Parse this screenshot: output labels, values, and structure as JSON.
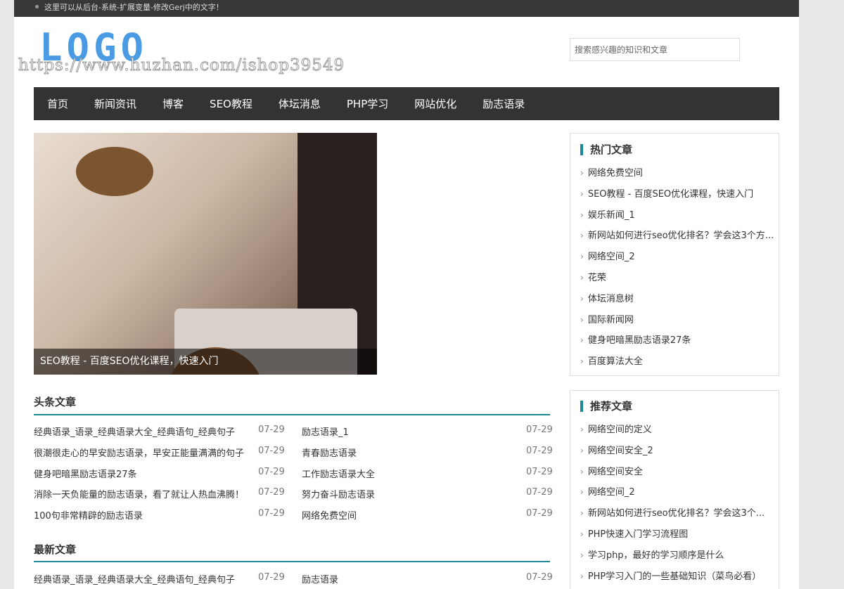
{
  "topbar": {
    "text": "这里可以从后台-系统-扩展变量-修改Gerj中的文字！"
  },
  "logo": {
    "text": "LOGO",
    "watermark": "https://www.huzhan.com/ishop39549"
  },
  "search": {
    "placeholder": "搜索感兴趣的知识和文章"
  },
  "nav": [
    "首页",
    "新闻资讯",
    "博客",
    "SEO教程",
    "体坛消息",
    "PHP学习",
    "网站优化",
    "励志语录"
  ],
  "hero": {
    "caption": "SEO教程 - 百度SEO优化课程，快速入门"
  },
  "headline": {
    "title": "头条文章",
    "left": [
      {
        "t": "经典语录_语录_经典语录大全_经典语句_经典句子",
        "d": "07-29"
      },
      {
        "t": "很潮很走心的早安励志语录，早安正能量满满的句子",
        "d": "07-29"
      },
      {
        "t": "健身吧暗黑励志语录27条",
        "d": "07-29"
      },
      {
        "t": "消除一天负能量的励志语录，看了就让人热血沸腾！",
        "d": "07-29"
      },
      {
        "t": "100句非常精辟的励志语录",
        "d": "07-29"
      }
    ],
    "right": [
      {
        "t": "励志语录_1",
        "d": "07-29"
      },
      {
        "t": "青春励志语录",
        "d": "07-29"
      },
      {
        "t": "工作励志语录大全",
        "d": "07-29"
      },
      {
        "t": "努力奋斗励志语录",
        "d": "07-29"
      },
      {
        "t": "网络免费空间",
        "d": "07-29"
      }
    ]
  },
  "latest": {
    "title": "最新文章",
    "left": [
      {
        "t": "经典语录_语录_经典语录大全_经典语句_经典句子",
        "d": "07-29"
      }
    ],
    "right": [
      {
        "t": "励志语录",
        "d": "07-29"
      }
    ]
  },
  "hot": {
    "title": "热门文章",
    "items": [
      "网络免费空间",
      "SEO教程 - 百度SEO优化课程，快速入门",
      "娱乐新闻_1",
      "新网站如何进行seo优化排名？学会这3个方...",
      "网络空间_2",
      "花荣",
      "体坛消息树",
      "国际新闻网",
      "健身吧暗黑励志语录27条",
      "百度算法大全"
    ]
  },
  "recommend": {
    "title": "推荐文章",
    "items": [
      "网络空间的定义",
      "网络空间安全_2",
      "网络空间安全",
      "网络空间_2",
      "新网站如何进行seo优化排名？学会这3个...",
      "PHP快速入门学习流程图",
      "学习php，最好的学习顺序是什么",
      "PHP学习入门的一些基础知识（菜鸟必看）"
    ]
  },
  "colors": {
    "accent": "#1a8a9a",
    "logo": "#4a9be3",
    "nav_bg": "#333333"
  }
}
